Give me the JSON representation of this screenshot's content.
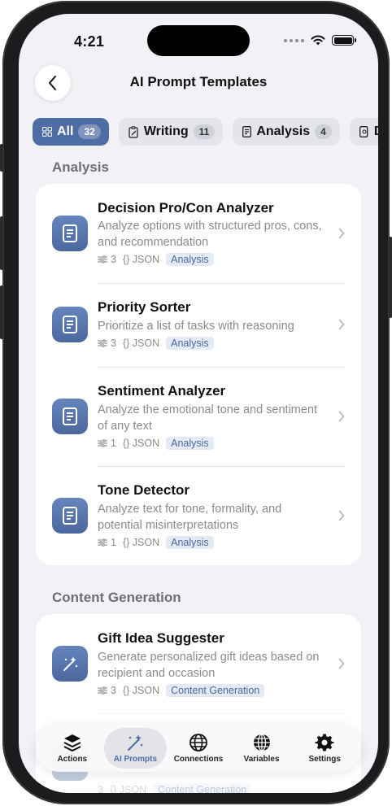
{
  "status": {
    "time": "4:21"
  },
  "header": {
    "title": "AI Prompt Templates"
  },
  "chips": [
    {
      "label": "All",
      "count": "32",
      "active": true
    },
    {
      "label": "Writing",
      "count": "11"
    },
    {
      "label": "Analysis",
      "count": "4"
    },
    {
      "label": "D"
    }
  ],
  "sections": [
    {
      "title": "Analysis",
      "items": [
        {
          "title": "Decision Pro/Con Analyzer",
          "desc": "Analyze options with structured pros, cons, and recommendation",
          "vars": "3",
          "format": "{} JSON",
          "tag": "Analysis",
          "icon": "document-icon"
        },
        {
          "title": "Priority Sorter",
          "desc": "Prioritize a list of tasks with reasoning",
          "vars": "3",
          "format": "{} JSON",
          "tag": "Analysis",
          "icon": "document-icon"
        },
        {
          "title": "Sentiment Analyzer",
          "desc": "Analyze the emotional tone and sentiment of any text",
          "vars": "1",
          "format": "{} JSON",
          "tag": "Analysis",
          "icon": "document-icon"
        },
        {
          "title": "Tone Detector",
          "desc": "Analyze text for tone, formality, and potential misinterpretations",
          "vars": "1",
          "format": "{} JSON",
          "tag": "Analysis",
          "icon": "document-icon"
        }
      ]
    },
    {
      "title": "Content Generation",
      "items": [
        {
          "title": "Gift Idea Suggester",
          "desc": "Generate personalized gift ideas based on recipient and occasion",
          "vars": "3",
          "format": "{} JSON",
          "tag": "Content Generation",
          "icon": "magic-wand-icon"
        },
        {
          "title": "",
          "desc": "",
          "vars": "3",
          "format": "{} JSON",
          "tag": "Content Generation",
          "icon": "magic-wand-icon"
        }
      ]
    }
  ],
  "tabbar": [
    {
      "label": "Actions",
      "icon": "stack-icon"
    },
    {
      "label": "AI Prompts",
      "icon": "magic-wand-icon",
      "active": true
    },
    {
      "label": "Connections",
      "icon": "globe-icon"
    },
    {
      "label": "Variables",
      "icon": "globe-grid-icon"
    },
    {
      "label": "Settings",
      "icon": "gear-icon"
    }
  ],
  "colors": {
    "accent": "#4f6da5",
    "background": "#f1f1f6",
    "tag_bg": "#e4ebf5"
  }
}
